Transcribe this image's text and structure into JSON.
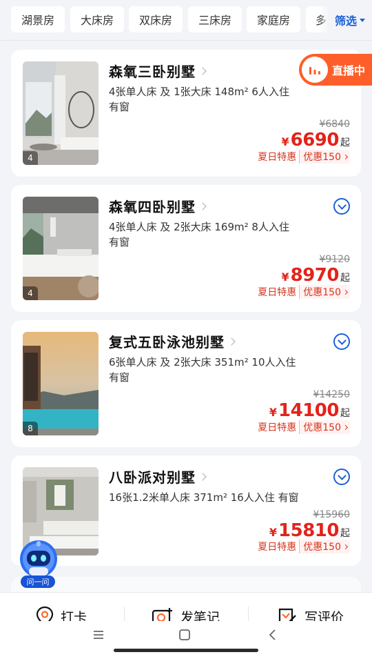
{
  "filters": {
    "chips": [
      "湖景房",
      "大床房",
      "双床房",
      "三床房",
      "家庭房",
      "多"
    ],
    "filter_label": "筛选"
  },
  "live_badge": {
    "label": "直播中"
  },
  "rooms": [
    {
      "title": "森氧三卧别墅",
      "desc_line1": "4张单人床 及 1张大床  148m²  6人入住",
      "desc_line2": "有窗",
      "photo_count": "4",
      "original_price": "¥6840",
      "currency": "¥",
      "price": "6690",
      "price_suffix": "起",
      "promo_label": "夏日特惠",
      "promo_badge": "优惠150"
    },
    {
      "title": "森氧四卧别墅",
      "desc_line1": "4张单人床 及 2张大床  169m²  8人入住",
      "desc_line2": "有窗",
      "photo_count": "4",
      "original_price": "¥9120",
      "currency": "¥",
      "price": "8970",
      "price_suffix": "起",
      "promo_label": "夏日特惠",
      "promo_badge": "优惠150"
    },
    {
      "title": "复式五卧泳池别墅",
      "desc_line1": "6张单人床 及 2张大床  351m²  10人入住",
      "desc_line2": "有窗",
      "photo_count": "8",
      "original_price": "¥14250",
      "currency": "¥",
      "price": "14100",
      "price_suffix": "起",
      "promo_label": "夏日特惠",
      "promo_badge": "优惠150"
    },
    {
      "title": "八卧派对别墅",
      "desc_line1": "16张1.2米单人床  371m²  16人入住  有窗",
      "original_price": "¥15960",
      "currency": "¥",
      "price": "15810",
      "price_suffix": "起",
      "promo_label": "夏日特惠",
      "promo_badge": "优惠150"
    }
  ],
  "assistant": {
    "label": "问一问"
  },
  "bottom_bar": {
    "checkin": "打卡",
    "post_note": "发笔记",
    "write_review": "写评价"
  },
  "colors": {
    "accent_blue": "#1a5fd6",
    "price_red": "#e2231a",
    "live_orange": "#fe5e2a"
  }
}
